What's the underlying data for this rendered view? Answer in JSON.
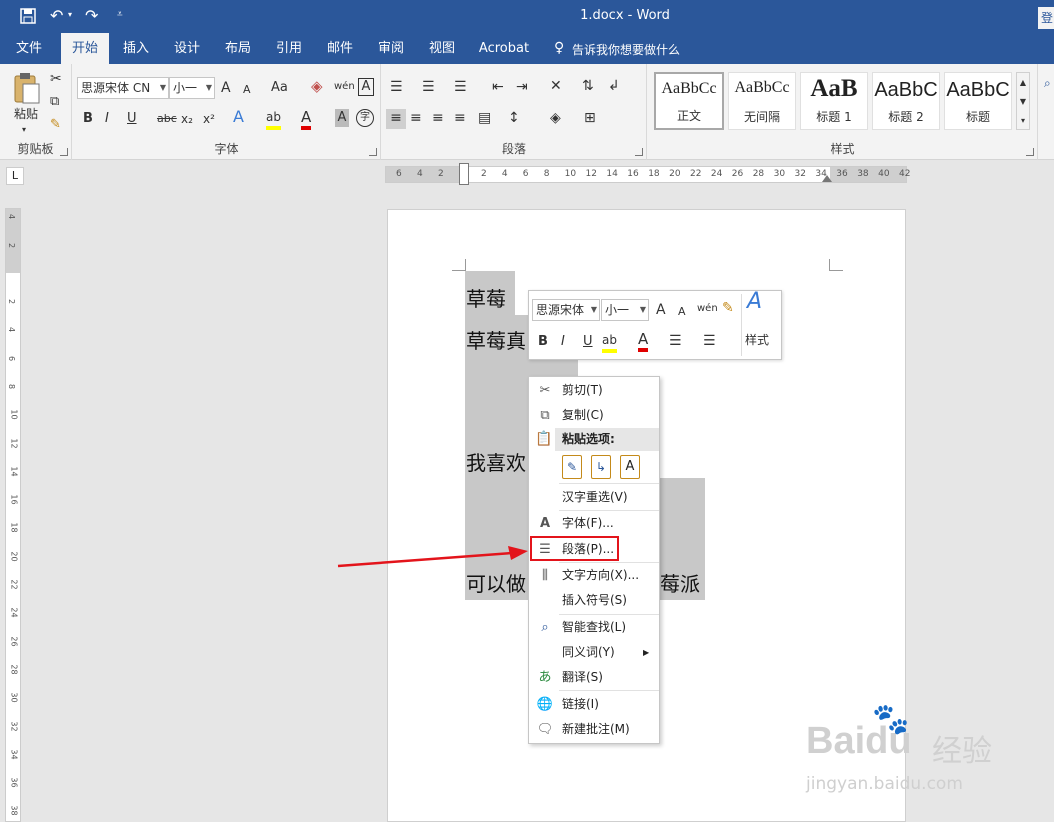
{
  "title_bar": {
    "window_title": "1.docx - Word",
    "save_icon": "save-icon",
    "undo_icon": "undo-icon",
    "redo_icon": "redo-icon",
    "customize_icon": "customize-qat-icon",
    "right_edge_text": "登"
  },
  "tabs": [
    {
      "label": "文件"
    },
    {
      "label": "开始",
      "active": true
    },
    {
      "label": "插入"
    },
    {
      "label": "设计"
    },
    {
      "label": "布局"
    },
    {
      "label": "引用"
    },
    {
      "label": "邮件"
    },
    {
      "label": "审阅"
    },
    {
      "label": "视图"
    },
    {
      "label": "Acrobat"
    }
  ],
  "tell_me": {
    "label": "告诉我你想要做什么",
    "icon": "lightbulb-icon"
  },
  "ribbon": {
    "clipboard": {
      "label": "剪贴板",
      "paste": "粘贴"
    },
    "font": {
      "label": "字体",
      "font_name": "思源宋体 CN",
      "font_size": "小一",
      "grow": "A",
      "shrink": "A",
      "case": "Aa",
      "pinyin": "wén",
      "border_a": "A",
      "bold": "B",
      "italic": "I",
      "underline": "U",
      "strike": "abc",
      "sub": "x₂",
      "sup": "x²",
      "effects": "A",
      "highlight": "ab",
      "color": "A",
      "shade": "A",
      "circle": "字"
    },
    "paragraph": {
      "label": "段落"
    },
    "styles": {
      "label": "样式",
      "items": [
        {
          "preview": "AaBbCc",
          "name": "正文"
        },
        {
          "preview": "AaBbCc",
          "name": "无间隔"
        },
        {
          "preview": "AaB",
          "name": "标题 1"
        },
        {
          "preview": "AaBbC",
          "name": "标题 2"
        },
        {
          "preview": "AaBbC",
          "name": "标题"
        }
      ]
    }
  },
  "ruler": {
    "tab_selector": "L",
    "h_numbers": [
      "6",
      "4",
      "2",
      "2",
      "4",
      "6",
      "8",
      "10",
      "12",
      "14",
      "16",
      "18",
      "20",
      "22",
      "24",
      "26",
      "28",
      "30",
      "32",
      "34",
      "36",
      "38",
      "40",
      "42"
    ],
    "v_numbers": [
      "4",
      "2",
      "2",
      "4",
      "6",
      "8",
      "10",
      "12",
      "14",
      "16",
      "18",
      "20",
      "22",
      "24",
      "26",
      "28",
      "30",
      "32",
      "34",
      "36",
      "38"
    ]
  },
  "document": {
    "lines": [
      "草莓",
      "草莓真",
      "我喜欢",
      "可以做",
      "莓派"
    ]
  },
  "mini_toolbar": {
    "font_name": "思源宋体",
    "font_size": "小一",
    "grow": "A",
    "shrink": "A",
    "pinyin": "wén",
    "bold": "B",
    "italic": "I",
    "underline": "U",
    "highlight": "ab",
    "color": "A",
    "styles": "样式"
  },
  "context_menu": {
    "items": [
      {
        "label": "剪切(T)",
        "icon": "scissors-icon"
      },
      {
        "label": "复制(C)",
        "icon": "copy-icon"
      },
      {
        "label": "粘贴选项:",
        "icon": "paste-icon"
      },
      {
        "label": "汉字重选(V)"
      },
      {
        "label": "字体(F)...",
        "icon": "font-icon"
      },
      {
        "label": "段落(P)...",
        "icon": "paragraph-icon",
        "highlighted": true
      },
      {
        "label": "文字方向(X)...",
        "icon": "text-direction-icon"
      },
      {
        "label": "插入符号(S)"
      },
      {
        "label": "智能查找(L)",
        "icon": "smart-lookup-icon"
      },
      {
        "label": "同义词(Y)",
        "submenu": true
      },
      {
        "label": "翻译(S)",
        "icon": "translate-icon"
      },
      {
        "label": "链接(I)",
        "icon": "link-icon"
      },
      {
        "label": "新建批注(M)",
        "icon": "new-comment-icon"
      }
    ]
  },
  "watermark": {
    "brand": "Baidu",
    "suffix": "经验",
    "url": "jingyan.baidu.com"
  },
  "colors": {
    "accent": "#2b579a",
    "highlight_box": "#e3141b",
    "selection": "#c8c8c8"
  }
}
